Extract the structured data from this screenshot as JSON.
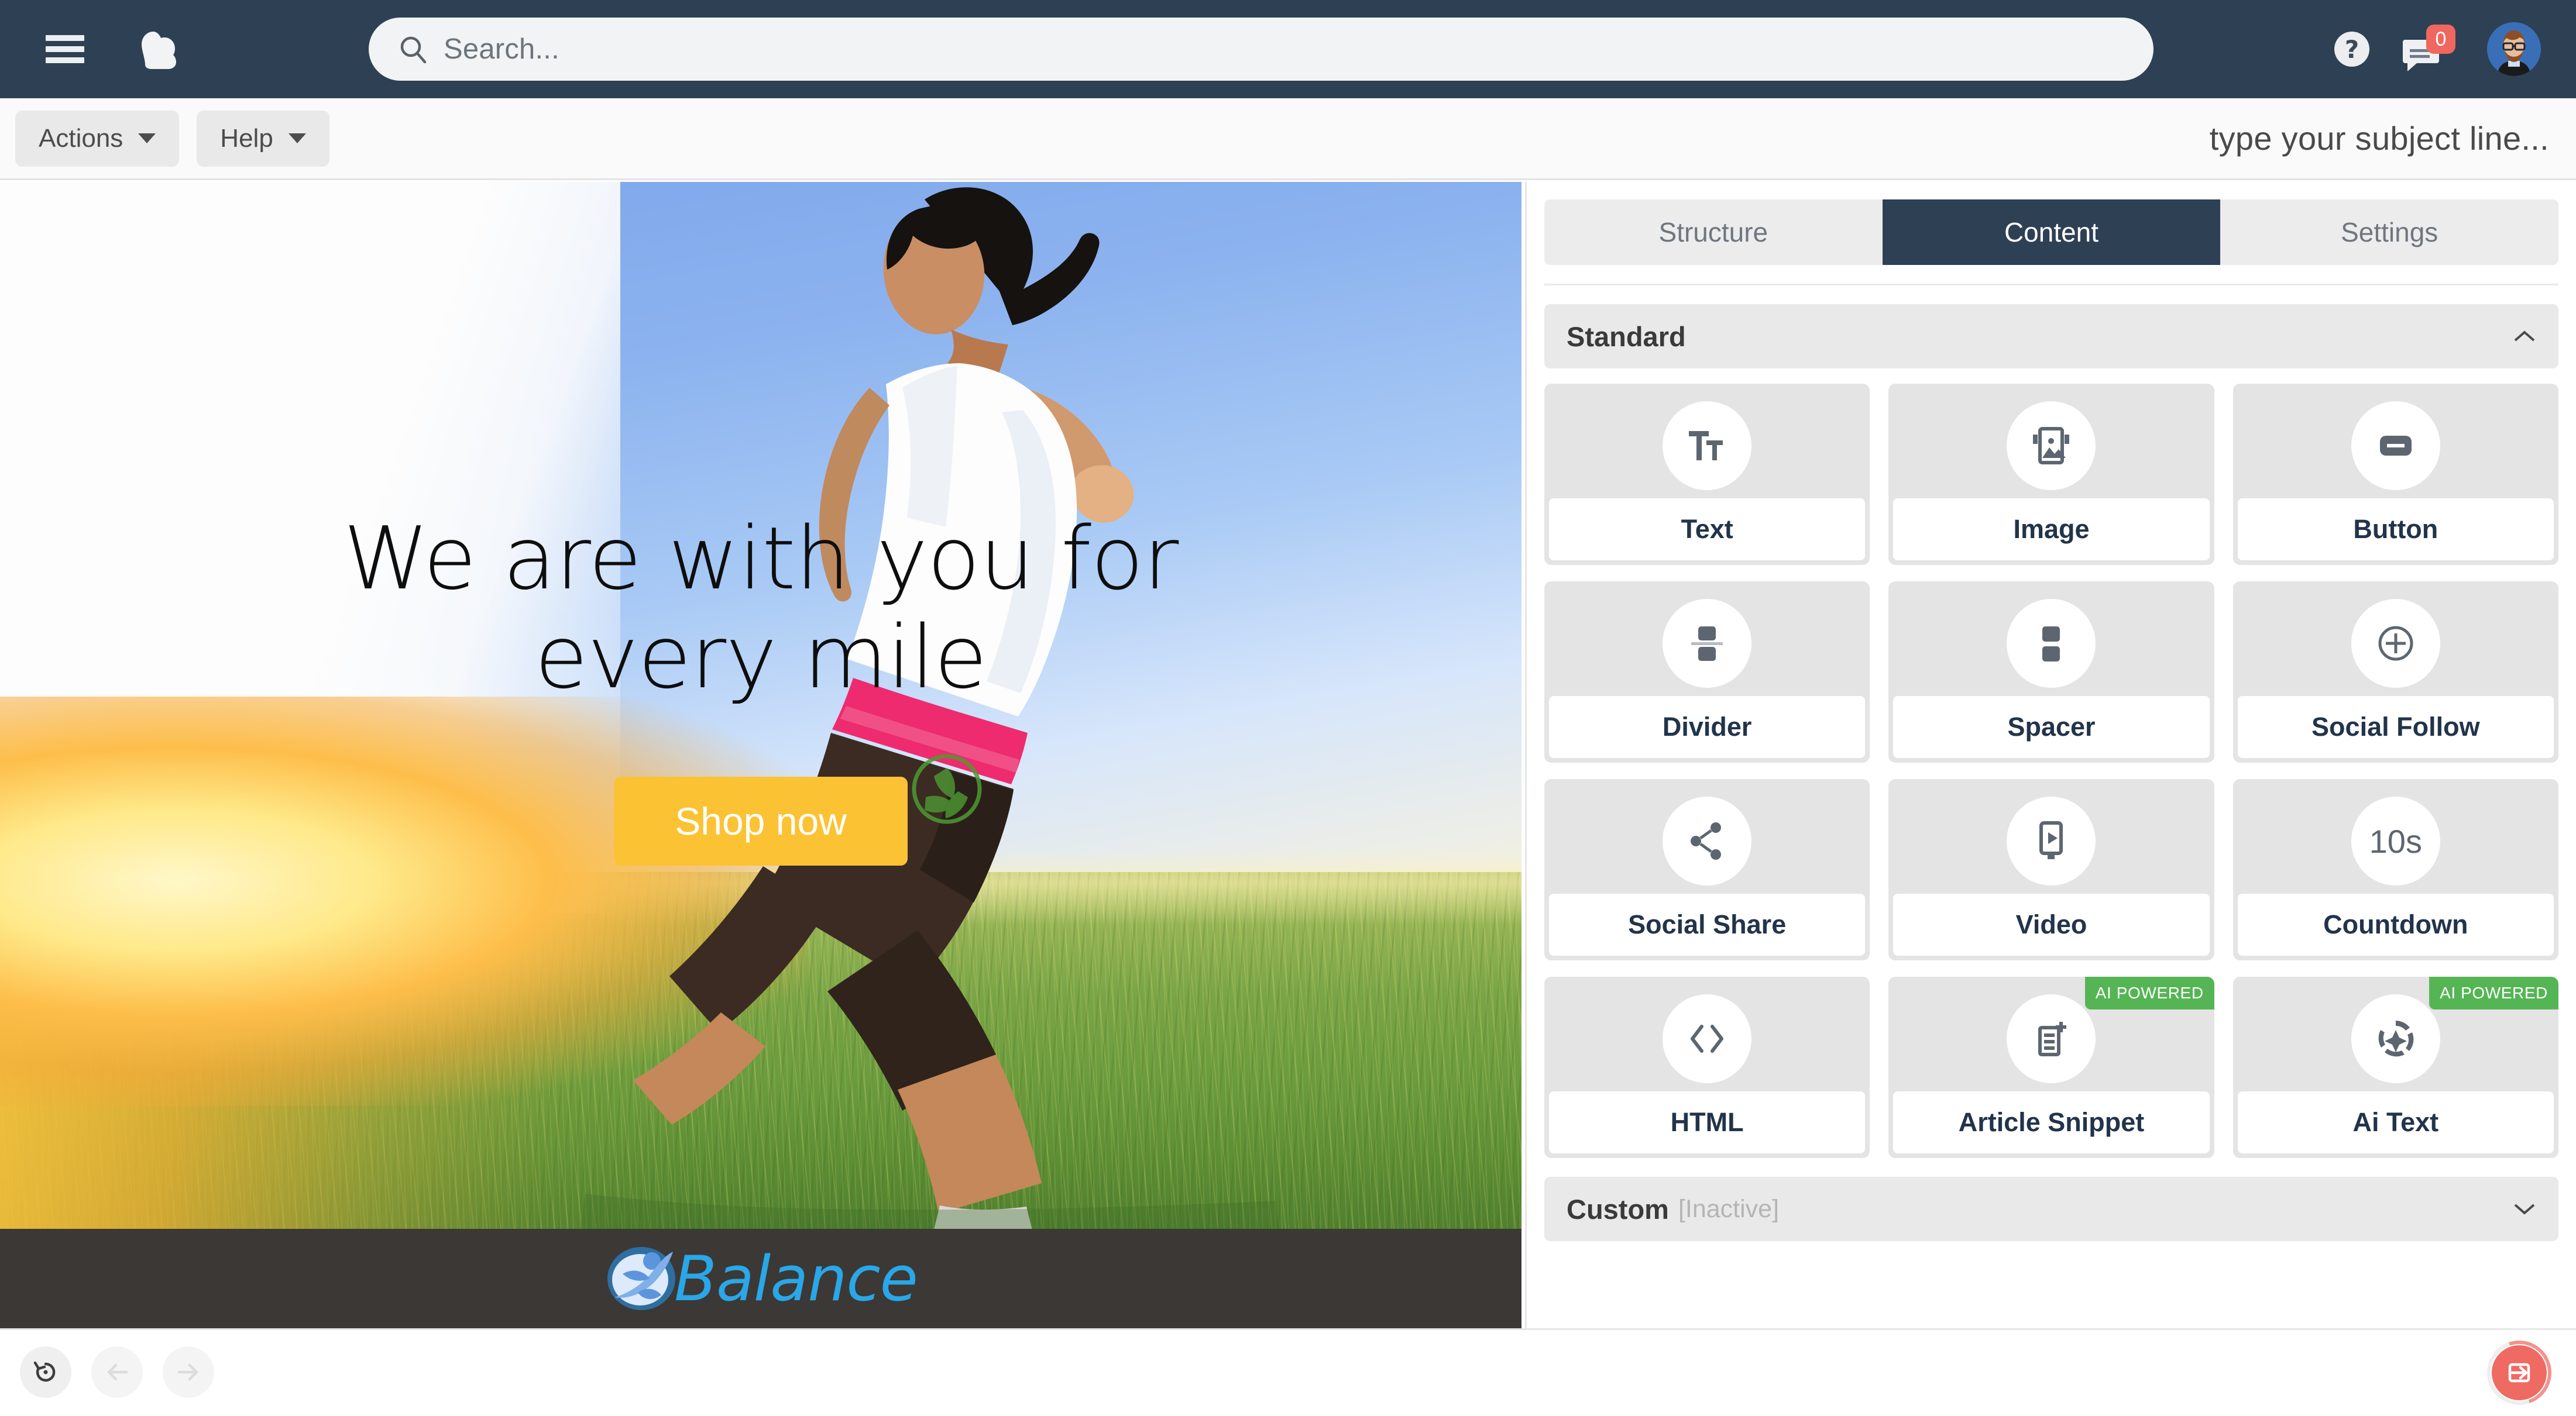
{
  "topnav": {
    "menu_icon": "hamburger-icon",
    "logo_icon": "cloud-logo-icon",
    "search": {
      "placeholder": "Search...",
      "value": "",
      "icon": "search-icon"
    },
    "help_icon": "question-mark-icon",
    "messages": {
      "icon": "message-icon",
      "badge_count": "0"
    },
    "avatar_icon": "user-avatar",
    "bg_color": "#2e4054"
  },
  "toolbar": {
    "actions_label": "Actions",
    "help_label": "Help",
    "subject_placeholder": "type your subject line..."
  },
  "canvas": {
    "hero_title_line1": "We are with you for",
    "hero_title_line2": "every mile",
    "cta_label": "Shop now",
    "cta_color": "#fbc233",
    "brand_name": "Balance",
    "brand_color": "#29a7e8",
    "brandbar_bg": "#3b3835"
  },
  "panel": {
    "tabs": [
      {
        "label": "Structure",
        "active": false
      },
      {
        "label": "Content",
        "active": true
      },
      {
        "label": "Settings",
        "active": false
      }
    ],
    "standard_section": {
      "title": "Standard",
      "expanded": true,
      "chevron": "chevron-up-icon",
      "tiles": [
        {
          "label": "Text",
          "icon": "text-icon",
          "badge": ""
        },
        {
          "label": "Image",
          "icon": "image-icon",
          "badge": ""
        },
        {
          "label": "Button",
          "icon": "button-icon",
          "badge": ""
        },
        {
          "label": "Divider",
          "icon": "divider-icon",
          "badge": ""
        },
        {
          "label": "Spacer",
          "icon": "spacer-icon",
          "badge": ""
        },
        {
          "label": "Social Follow",
          "icon": "plus-circle-icon",
          "badge": ""
        },
        {
          "label": "Social Share",
          "icon": "share-icon",
          "badge": ""
        },
        {
          "label": "Video",
          "icon": "video-play-icon",
          "badge": ""
        },
        {
          "label": "Countdown",
          "icon": "countdown-10s-icon",
          "badge": "",
          "icon_text": "10s"
        },
        {
          "label": "HTML",
          "icon": "code-brackets-icon",
          "badge": ""
        },
        {
          "label": "Article Snippet",
          "icon": "article-add-icon",
          "badge": "AI POWERED"
        },
        {
          "label": "Ai Text",
          "icon": "ai-sparkle-icon",
          "badge": "AI POWERED"
        }
      ]
    },
    "custom_section": {
      "title": "Custom",
      "status": "[Inactive]",
      "expanded": false,
      "chevron": "chevron-down-icon"
    },
    "badge_color": "#55b555"
  },
  "bottombar": {
    "undo_icon": "undo-history-icon",
    "back_icon": "arrow-left-icon",
    "forward_icon": "arrow-right-icon",
    "save_exit_icon": "exit-arrow-icon",
    "fab_color": "#ef6a63"
  }
}
